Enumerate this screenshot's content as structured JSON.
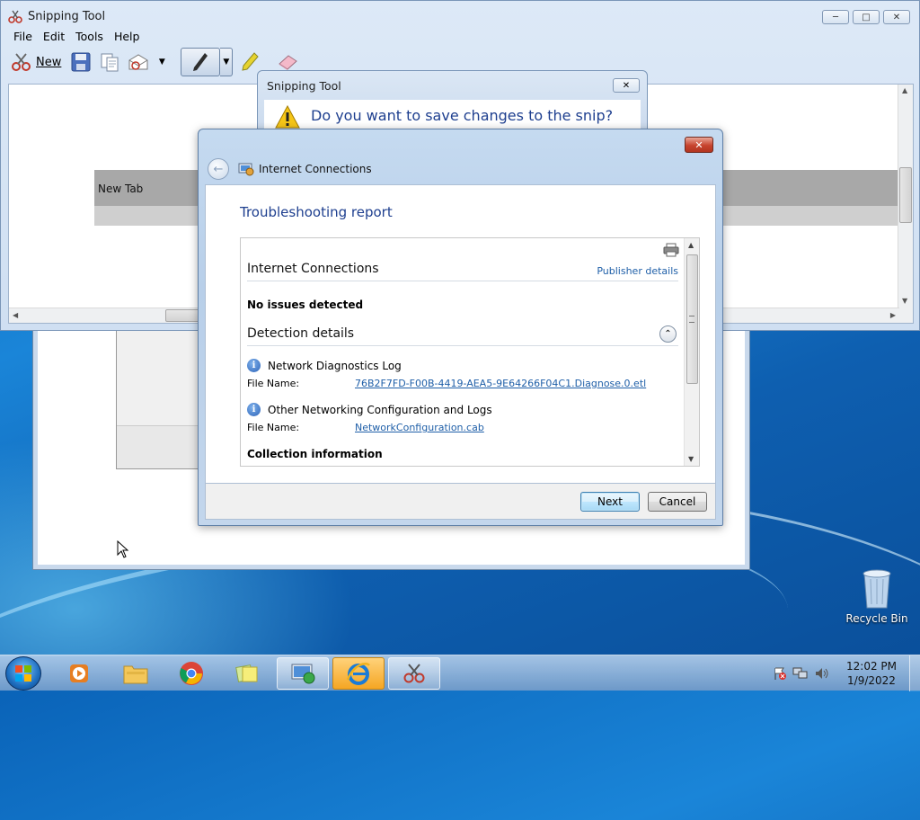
{
  "snipping_tool": {
    "title": "Snipping Tool",
    "menu": [
      "File",
      "Edit",
      "Tools",
      "Help"
    ],
    "toolbar": {
      "new_label": "New"
    },
    "capture_tab_text": "New Tab"
  },
  "save_dialog": {
    "title": "Snipping Tool",
    "question": "Do you want to save changes to the snip?"
  },
  "internet_connections": {
    "app_title": "Internet Connections",
    "heading": "Troubleshooting report",
    "report": {
      "section_title": "Internet Connections",
      "publisher_link": "Publisher details",
      "status": "No issues detected",
      "details_title": "Detection details",
      "items": [
        {
          "title": "Network Diagnostics Log",
          "file_label": "File Name:",
          "file_name": "76B2F7FD-F00B-4419-AEA5-9E64266F04C1.Diagnose.0.etl"
        },
        {
          "title": "Other Networking Configuration and Logs",
          "file_label": "File Name:",
          "file_name": "NetworkConfiguration.cab"
        }
      ],
      "collection_title": "Collection information"
    },
    "buttons": {
      "next": "Next",
      "cancel": "Cancel"
    }
  },
  "desktop": {
    "recycle_bin_label": "Recycle Bin"
  },
  "taskbar": {
    "items": [
      "windows-media-player",
      "windows-explorer",
      "google-chrome",
      "sticky-notes",
      "network-troubleshooter",
      "internet-explorer",
      "snipping-tool"
    ],
    "clock_time": "12:02 PM",
    "clock_date": "1/9/2022"
  },
  "colors": {
    "accent_blue": "#1e3f8f",
    "link_blue": "#1f5fa8",
    "close_red": "#c7442e"
  }
}
